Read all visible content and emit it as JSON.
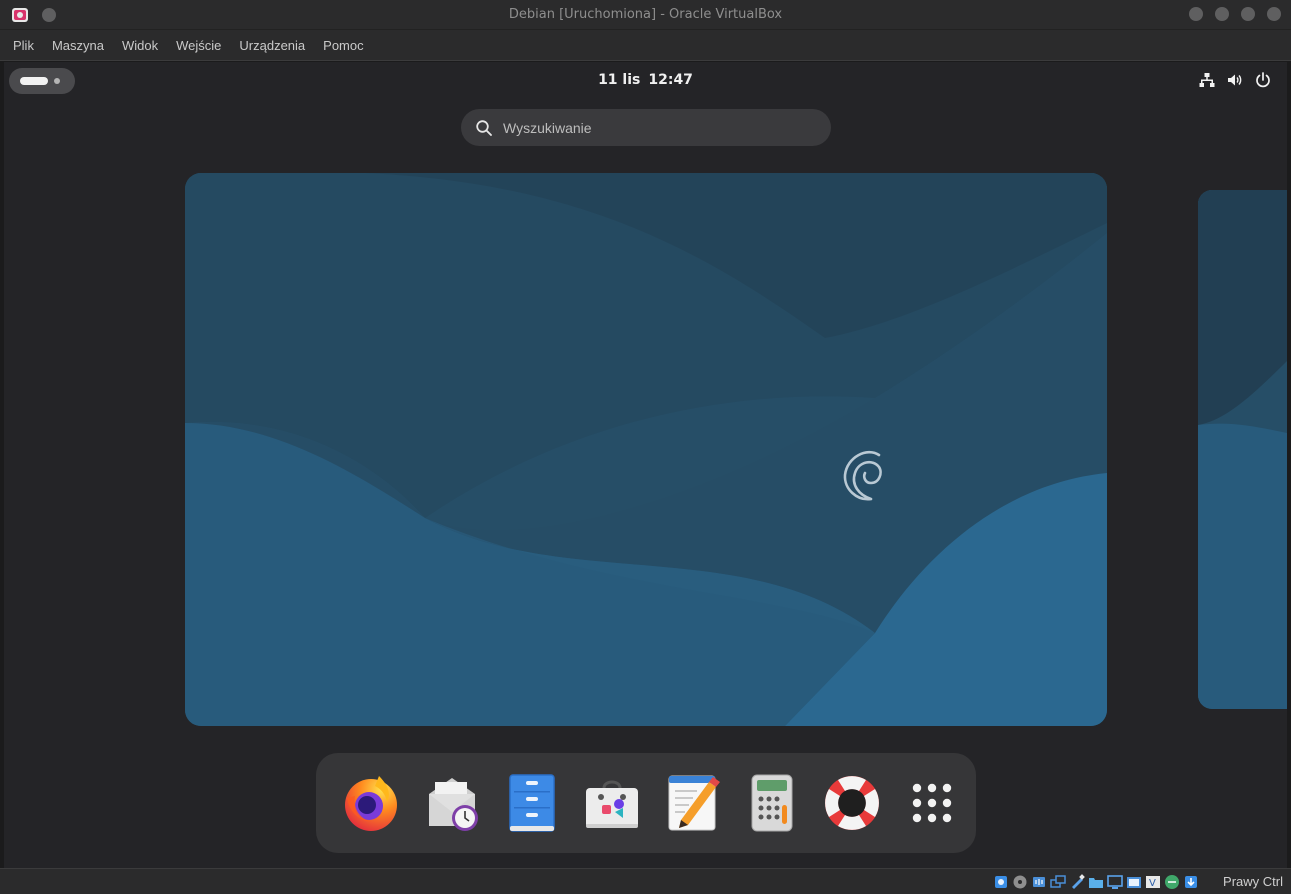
{
  "window": {
    "title": "Debian [Uruchomiona] - Oracle VirtualBox"
  },
  "menubar": {
    "items": [
      "Plik",
      "Maszyna",
      "Widok",
      "Wejście",
      "Urządzenia",
      "Pomoc"
    ]
  },
  "topbar": {
    "date": "11 lis",
    "time": "12:47"
  },
  "search": {
    "placeholder": "Wyszukiwanie"
  },
  "dock": {
    "apps": [
      "firefox-icon",
      "evolution-mail-icon",
      "files-icon",
      "software-icon",
      "text-editor-icon",
      "calculator-icon",
      "help-icon",
      "app-grid-icon"
    ]
  },
  "statusbar": {
    "host_key": "Prawy Ctrl"
  },
  "colors": {
    "wallpaper": "#244d66",
    "panel": "#242427",
    "dock": "#363638"
  }
}
